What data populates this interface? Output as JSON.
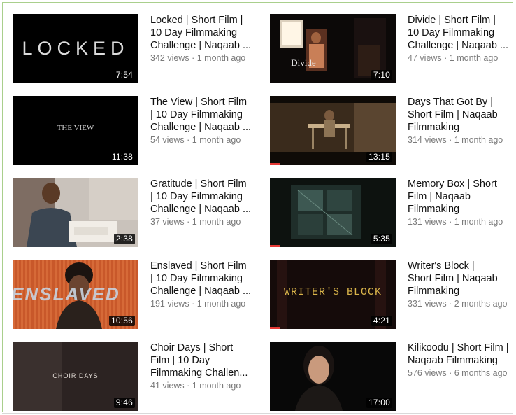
{
  "videos": [
    {
      "title": "Locked | Short Film |\n10 Day Filmmaking\nChallenge | Naqaab ...",
      "views": "342 views",
      "age": "1 month ago",
      "duration": "7:54",
      "thumb_text": "LOCKED",
      "progress": 0
    },
    {
      "title": "Divide | Short Film |\n10 Day Filmmaking\nChallenge | Naqaab ...",
      "views": "47 views",
      "age": "1 month ago",
      "duration": "7:10",
      "thumb_text": "Divide",
      "progress": 0
    },
    {
      "title": "The View | Short Film\n| 10 Day Filmmaking\nChallenge | Naqaab ...",
      "views": "54 views",
      "age": "1 month ago",
      "duration": "11:38",
      "thumb_text": "THE VIEW",
      "progress": 0
    },
    {
      "title": "Days That Got By |\nShort Film | Naqaab\nFilmmaking",
      "views": "314 views",
      "age": "1 month ago",
      "duration": "13:15",
      "thumb_text": "",
      "progress": 0.08
    },
    {
      "title": "Gratitude | Short Film\n| 10 Day Filmmaking\nChallenge | Naqaab ...",
      "views": "37 views",
      "age": "1 month ago",
      "duration": "2:38",
      "thumb_text": "",
      "progress": 0
    },
    {
      "title": "Memory Box | Short\nFilm | Naqaab\nFilmmaking",
      "views": "131 views",
      "age": "1 month ago",
      "duration": "5:35",
      "thumb_text": "",
      "progress": 0.08
    },
    {
      "title": "Enslaved | Short Film\n| 10 Day Filmmaking\nChallenge | Naqaab ...",
      "views": "191 views",
      "age": "1 month ago",
      "duration": "10:56",
      "thumb_text": "ENSLAVED",
      "progress": 0
    },
    {
      "title": "Writer's Block |\nShort Film | Naqaab\nFilmmaking",
      "views": "331 views",
      "age": "2 months ago",
      "duration": "4:21",
      "thumb_text": "WRITER'S BLOCK",
      "progress": 0.08
    },
    {
      "title": "Choir Days | Short\nFilm | 10 Day\nFilmmaking Challen...",
      "views": "41 views",
      "age": "1 month ago",
      "duration": "9:46",
      "thumb_text": "CHOIR DAYS",
      "progress": 0
    },
    {
      "title": "Kilikoodu | Short Film |\nNaqaab Filmmaking",
      "views": "576 views",
      "age": "6 months ago",
      "duration": "17:00",
      "thumb_text": "",
      "progress": 0
    }
  ],
  "separator": "·",
  "colors": {
    "frame": "#a9cf8c",
    "progress": "#e53935"
  }
}
